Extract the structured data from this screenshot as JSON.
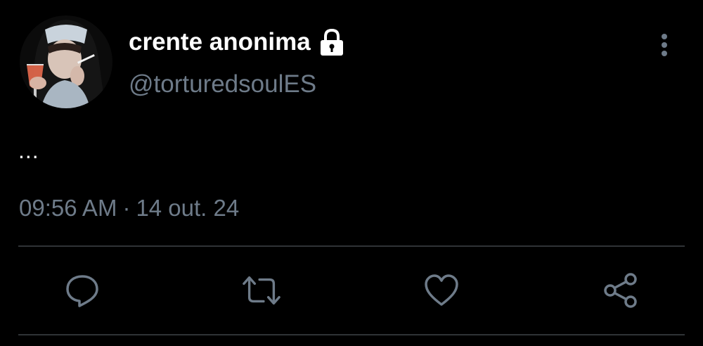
{
  "user": {
    "display_name": "crente anonima",
    "handle": "@torturedsoulES",
    "avatar_icon": "nun-avatar",
    "protected_icon": "lock-icon"
  },
  "tweet": {
    "text": "...",
    "time": "09:56 AM",
    "separator": "·",
    "date": "14 out. 24"
  },
  "actions": {
    "reply_icon": "reply-icon",
    "retweet_icon": "retweet-icon",
    "like_icon": "heart-icon",
    "share_icon": "share-icon",
    "more_icon": "more-vertical-icon"
  },
  "colors": {
    "background": "#000000",
    "primary_text": "#ffffff",
    "secondary_text": "#6e7b89",
    "divider": "#2f3336"
  }
}
